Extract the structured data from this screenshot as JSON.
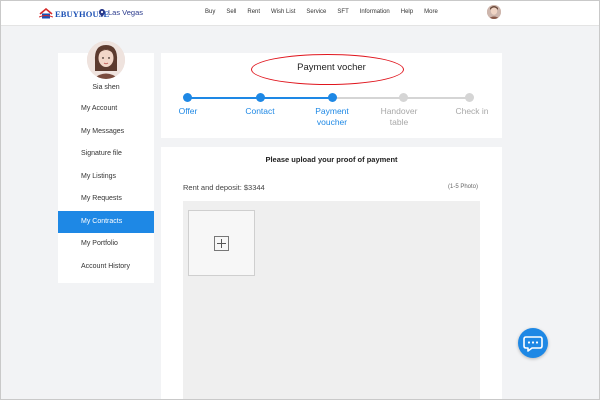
{
  "header": {
    "logo_text": "EBUYHOUSE",
    "location": "Las Vegas",
    "nav_items": [
      "Buy",
      "Sell",
      "Rent",
      "Wish List",
      "Service",
      "SFT",
      "Information",
      "Help",
      "More"
    ]
  },
  "sidebar": {
    "user_name": "Sia shen",
    "items": [
      {
        "label": "My Account",
        "active": false
      },
      {
        "label": "My Messages",
        "active": false
      },
      {
        "label": "Signature file",
        "active": false
      },
      {
        "label": "My Listings",
        "active": false
      },
      {
        "label": "My Requests",
        "active": false
      },
      {
        "label": "My Contracts",
        "active": true
      },
      {
        "label": "My Portfolio",
        "active": false
      },
      {
        "label": "Account History",
        "active": false
      }
    ]
  },
  "steps": {
    "title": "Payment vocher",
    "items": [
      {
        "label": "Offer",
        "state": "done"
      },
      {
        "label": "Contact",
        "state": "done"
      },
      {
        "label": "Payment voucher",
        "state": "current"
      },
      {
        "label": "Handover table",
        "state": "pending"
      },
      {
        "label": "Check in",
        "state": "pending"
      }
    ]
  },
  "upload": {
    "title": "Please upload your proof of payment",
    "deposit_text": "Rent and deposit: $3344",
    "photo_limit": "(1-5 Photo)"
  },
  "icons": {
    "logo": "house-logo-icon",
    "location": "location-pin-icon",
    "add_photo": "plus-icon",
    "chat": "chat-bubble-icon"
  },
  "colors": {
    "accent": "#1e88e5",
    "annotation_red": "#e0161e",
    "pending": "#d5d5d5",
    "pending_text": "#a8a8a8"
  }
}
